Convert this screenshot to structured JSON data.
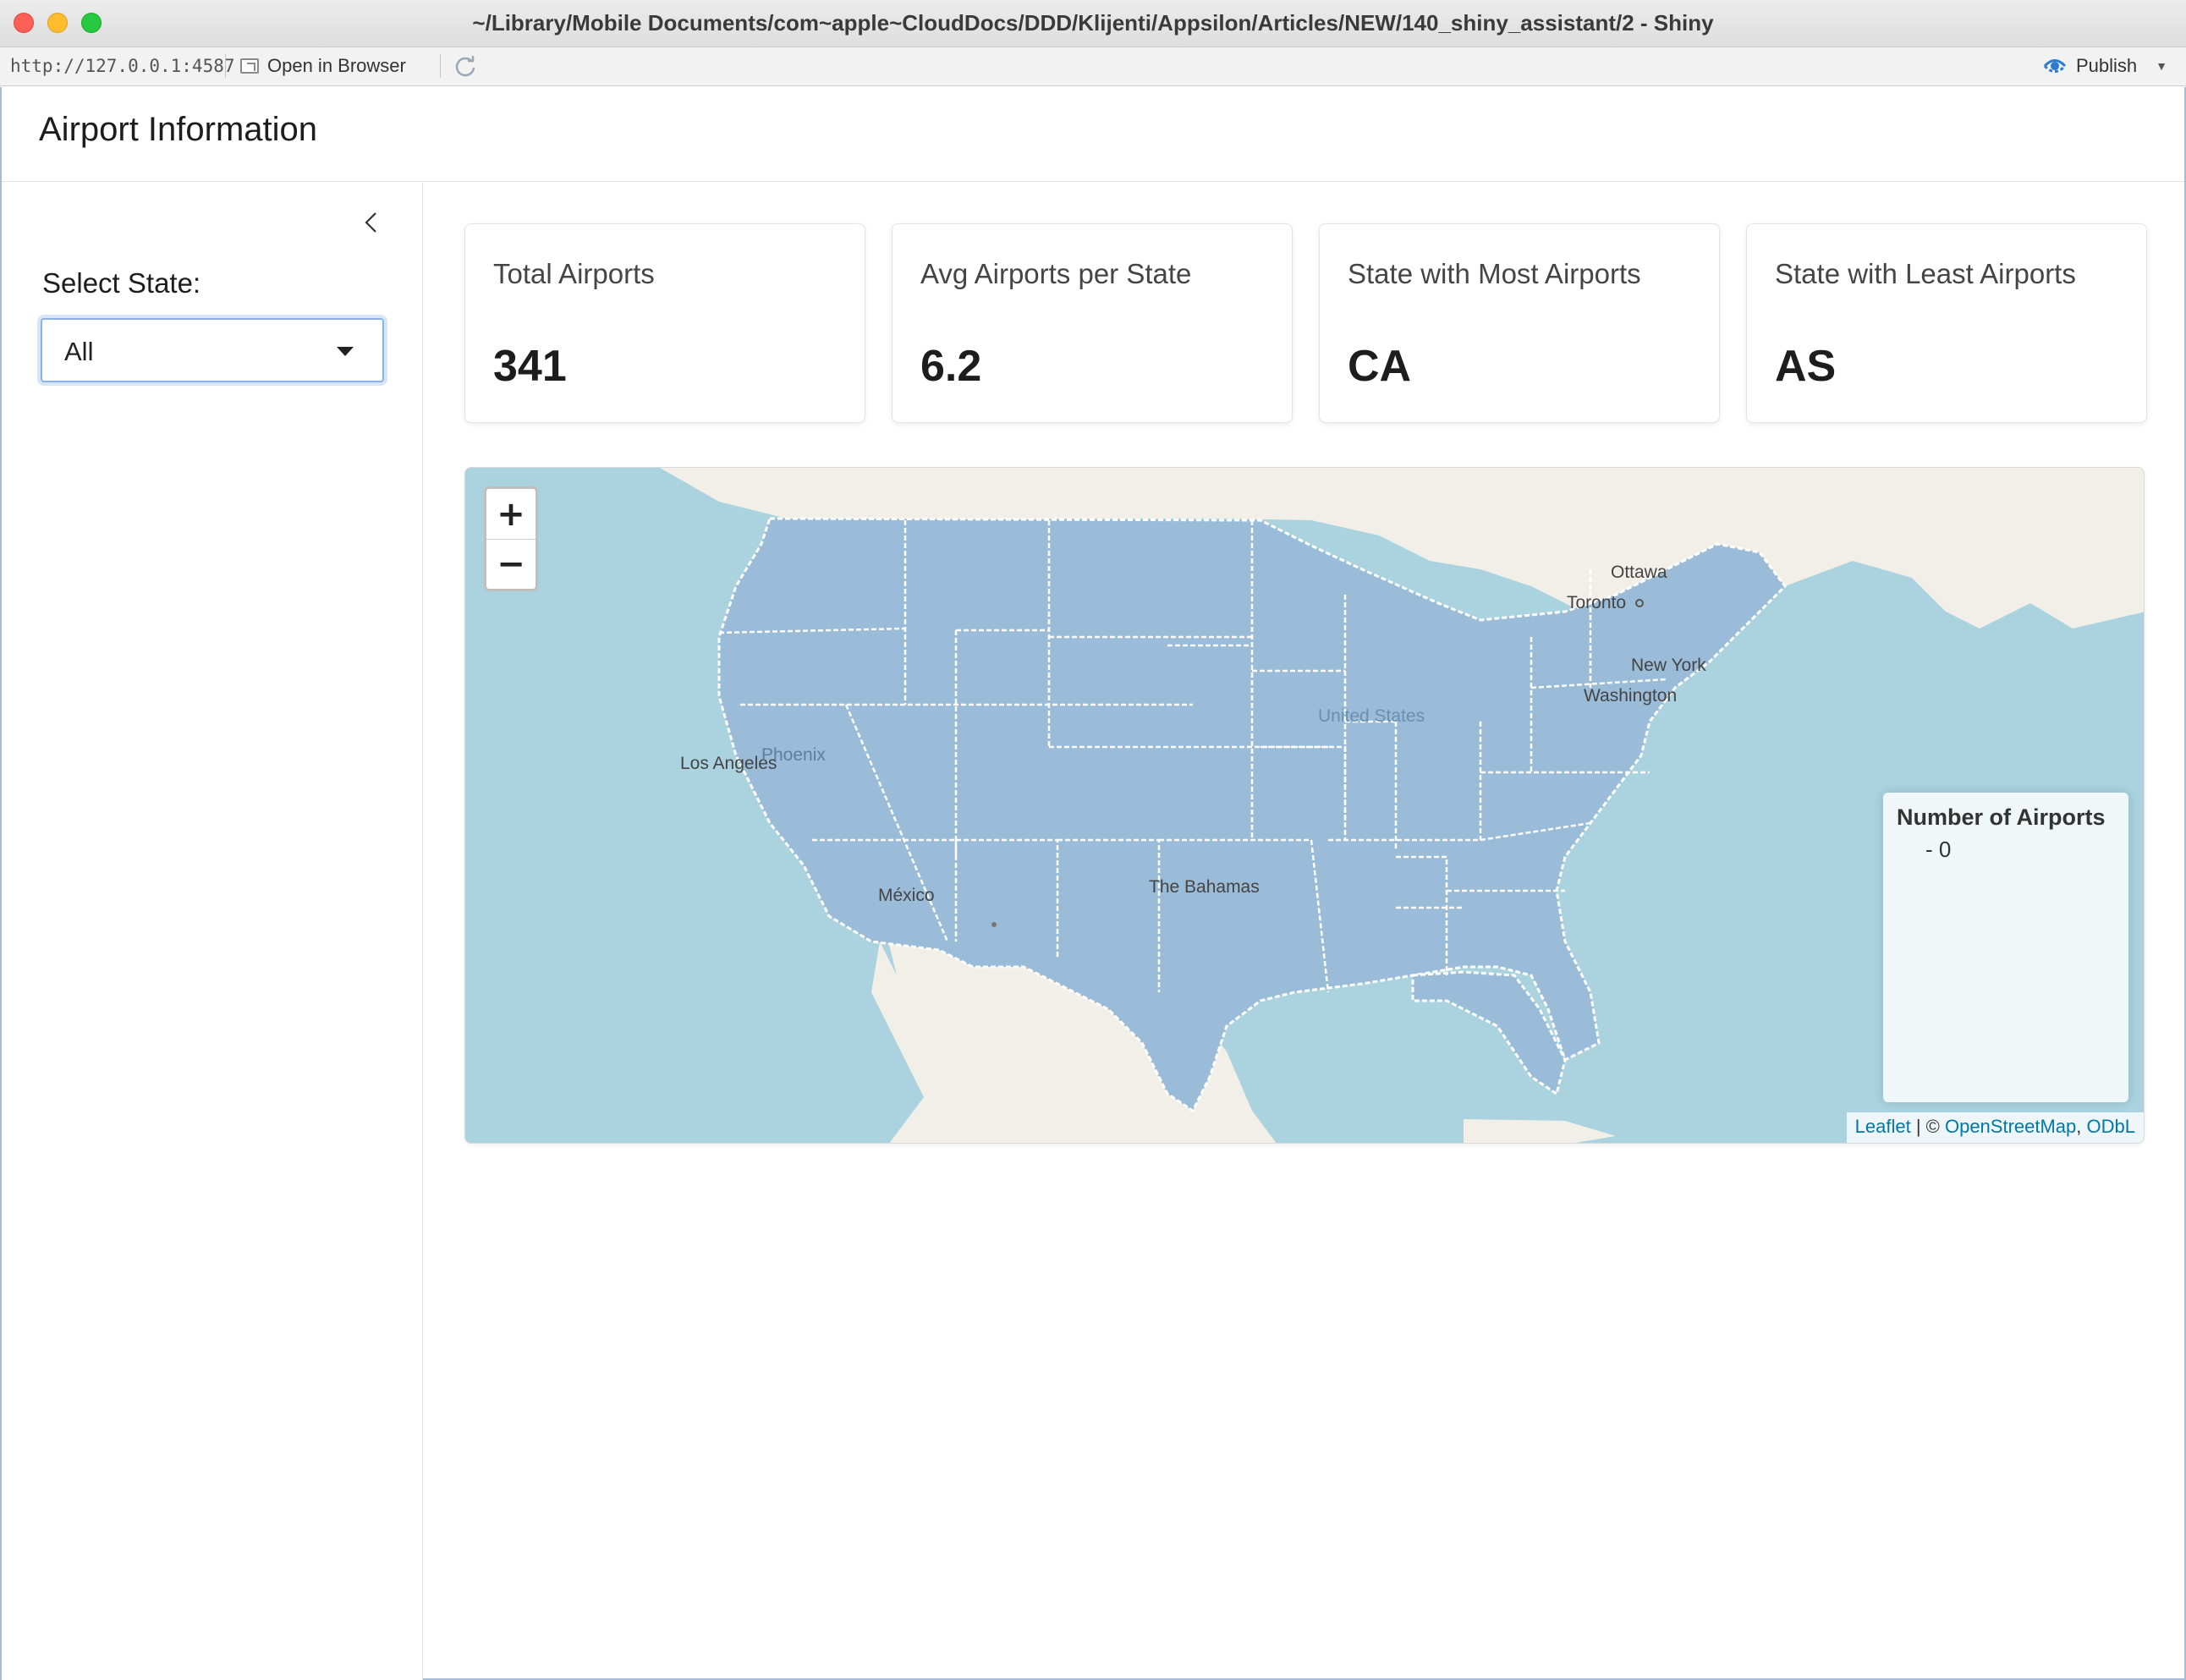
{
  "window": {
    "title": "~/Library/Mobile Documents/com~apple~CloudDocs/DDD/Klijenti/Appsilon/Articles/NEW/140_shiny_assistant/2 - Shiny"
  },
  "toolbar": {
    "url": "http://127.0.0.1:4587",
    "open_in_browser": "Open in Browser",
    "publish": "Publish"
  },
  "app": {
    "title": "Airport Information"
  },
  "sidebar": {
    "select_label": "Select State:",
    "select_value": "All"
  },
  "cards": [
    {
      "label": "Total Airports",
      "value": "341"
    },
    {
      "label": "Avg Airports per State",
      "value": "6.2"
    },
    {
      "label": "State with Most Airports",
      "value": "CA"
    },
    {
      "label": "State with Least Airports",
      "value": "AS"
    }
  ],
  "map": {
    "zoom_in": "+",
    "zoom_out": "−",
    "legend_title": "Number of Airports",
    "legend_item": "- 0",
    "attribution": {
      "leaflet": "Leaflet",
      "sep": " | © ",
      "osm": "OpenStreetMap",
      "comma": ", ",
      "odbl": "ODbL"
    },
    "labels": {
      "ottawa": "Ottawa",
      "toronto": "Toronto",
      "new_york": "New York",
      "washington": "Washington",
      "united_states": "United States",
      "los_angeles": "Los Angeles",
      "phoenix": "Phoenix",
      "mexico": "México",
      "bahamas": "The Bahamas"
    },
    "colors": {
      "water": "#aad3df",
      "land": "#f2efe9",
      "state_fill": "#9bbcd8",
      "state_border": "#ffffff"
    }
  }
}
